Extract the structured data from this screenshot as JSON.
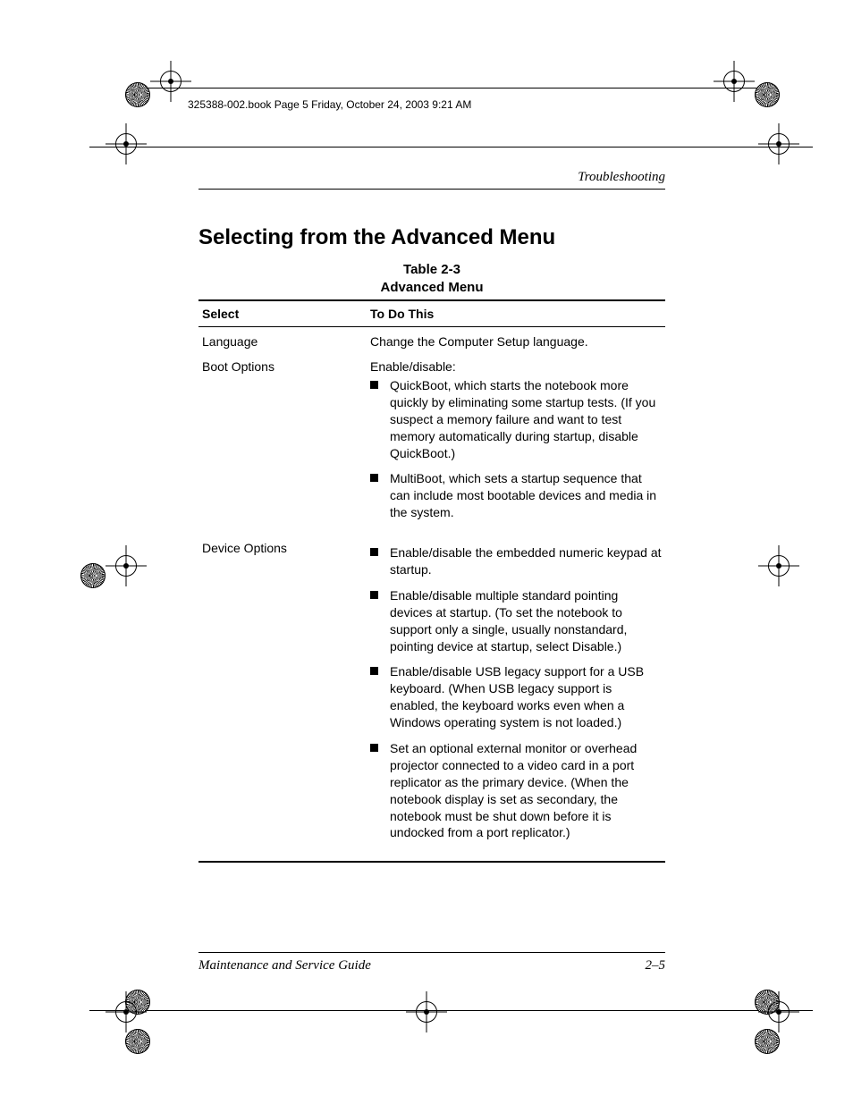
{
  "runhead": "325388-002.book  Page 5  Friday, October 24, 2003  9:21 AM",
  "section_label": "Troubleshooting",
  "heading": "Selecting from the Advanced Menu",
  "table": {
    "number": "Table 2-3",
    "title": "Advanced Menu",
    "head": {
      "col1": "Select",
      "col2": "To Do This"
    },
    "rows": [
      {
        "select": "Language",
        "lead": "Change the Computer Setup language.",
        "bullets": []
      },
      {
        "select": "Boot Options",
        "lead": "Enable/disable:",
        "bullets": [
          "QuickBoot, which starts the notebook more quickly by eliminating some startup tests. (If you suspect a memory failure and want to test memory automatically during startup, disable QuickBoot.)",
          "MultiBoot, which sets a startup sequence that can include most bootable devices and media in the system."
        ]
      },
      {
        "select": "Device Options",
        "lead": "",
        "bullets": [
          "Enable/disable the embedded numeric keypad at startup.",
          "Enable/disable multiple standard pointing devices at startup. (To set the notebook to support only a single, usually nonstandard, pointing device at startup, select Disable.)",
          "Enable/disable USB legacy support for a USB keyboard. (When USB legacy support is enabled, the keyboard works even when a Windows operating system is not loaded.)",
          "Set an optional external monitor or overhead projector connected to a video card in a port replicator as the primary device. (When the notebook display is set as secondary, the notebook must be shut down before it is undocked from a port replicator.)"
        ]
      }
    ]
  },
  "footer": {
    "left": "Maintenance and Service Guide",
    "right": "2–5"
  }
}
